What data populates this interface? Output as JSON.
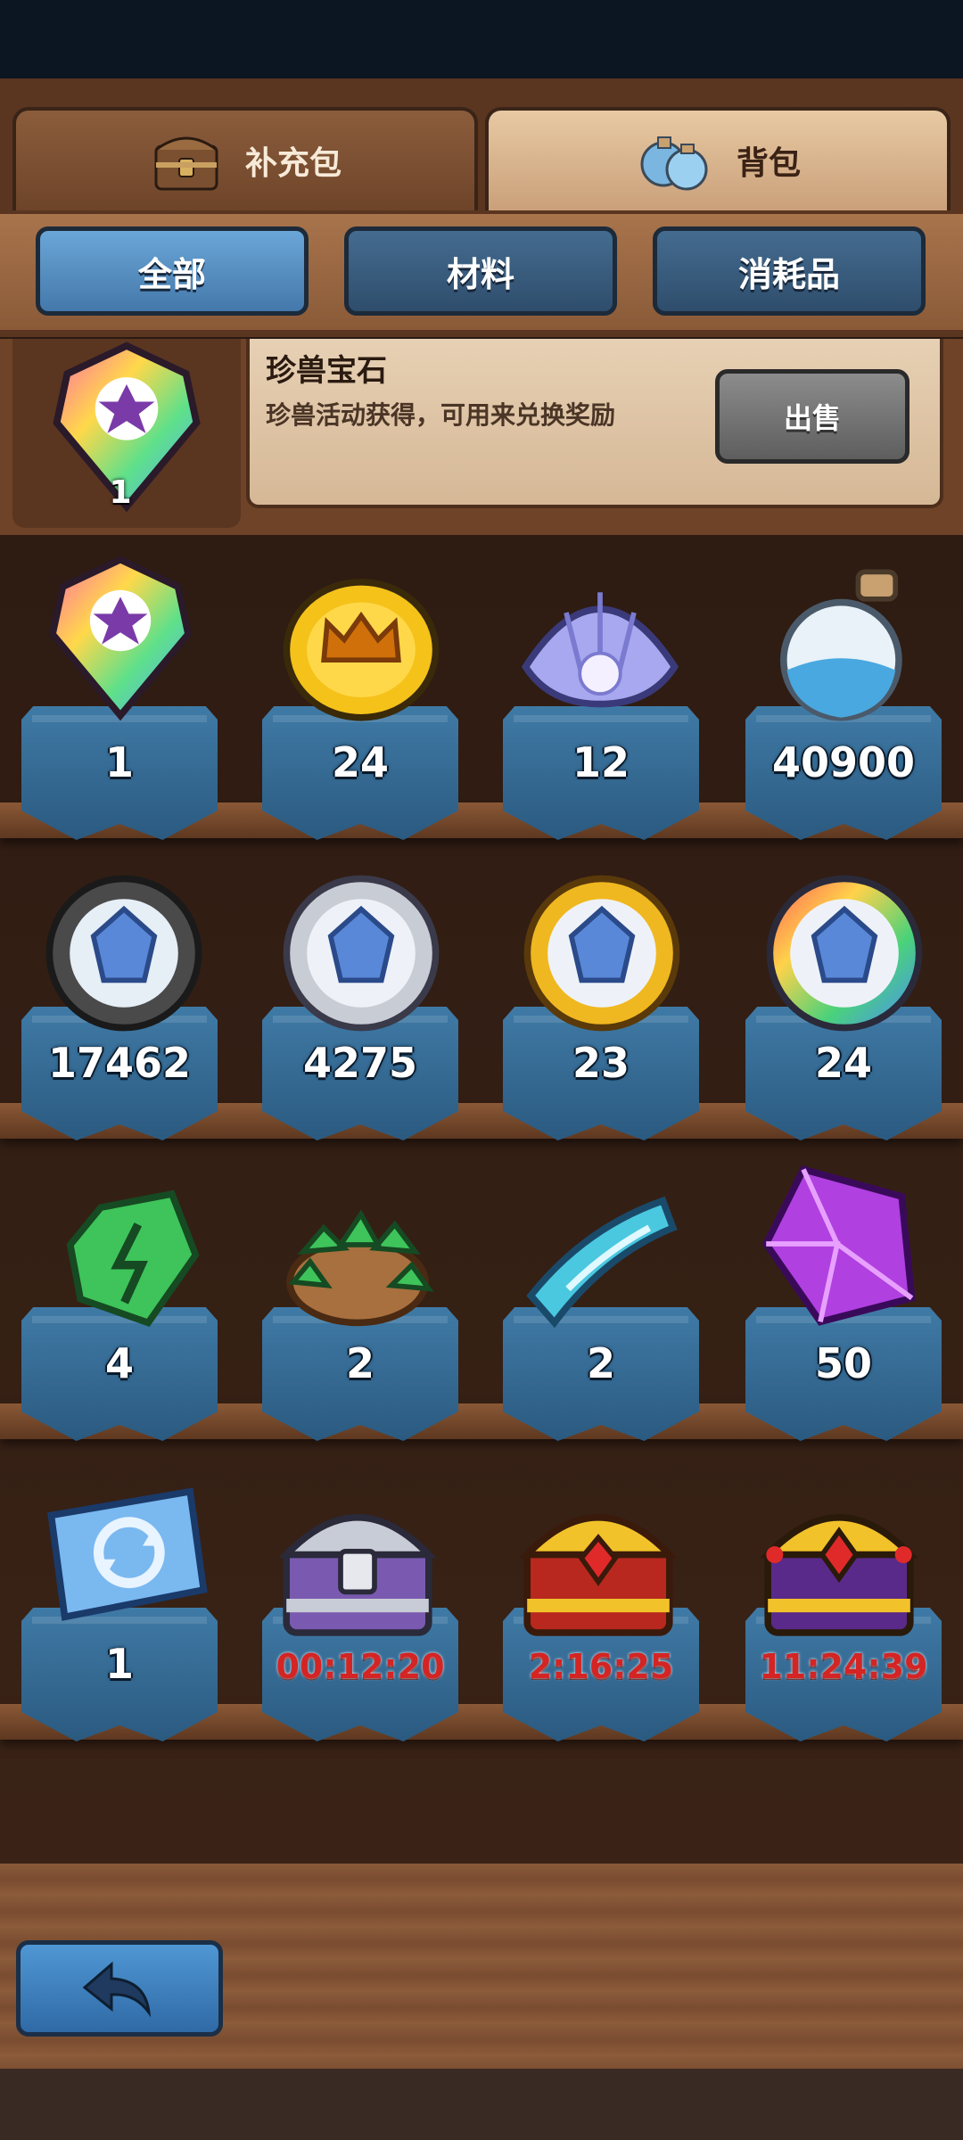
{
  "tabs": [
    {
      "label": "补充包",
      "icon": "chest-icon"
    },
    {
      "label": "背包",
      "icon": "potion-bag-icon"
    }
  ],
  "filters": [
    {
      "label": "全部",
      "active": true
    },
    {
      "label": "材料",
      "active": false
    },
    {
      "label": "消耗品",
      "active": false
    }
  ],
  "detail": {
    "name": "珍兽宝石",
    "description": "珍兽活动获得，可用来兑换奖励",
    "sell_label": "出售",
    "count": "1",
    "icon": "rainbow-gem-icon"
  },
  "items": [
    {
      "icon": "rainbow-gem-icon",
      "qty": "1"
    },
    {
      "icon": "gold-crown-coin-icon",
      "qty": "24"
    },
    {
      "icon": "pearl-shell-icon",
      "qty": "12"
    },
    {
      "icon": "blue-sand-bottle-icon",
      "qty": "40900"
    },
    {
      "icon": "dark-crystal-orb-icon",
      "qty": "17462"
    },
    {
      "icon": "silver-crystal-orb-icon",
      "qty": "4275"
    },
    {
      "icon": "gold-crystal-orb-icon",
      "qty": "23"
    },
    {
      "icon": "rainbow-crystal-orb-icon",
      "qty": "24"
    },
    {
      "icon": "green-rune-stone-icon",
      "qty": "4"
    },
    {
      "icon": "green-stone-bag-icon",
      "qty": "2"
    },
    {
      "icon": "blue-ticket-scroll-icon",
      "qty": "2"
    },
    {
      "icon": "purple-crystal-icon",
      "qty": "50"
    },
    {
      "icon": "refresh-ticket-icon",
      "qty": "1"
    },
    {
      "icon": "silver-chest-icon",
      "qty": "00:12:20",
      "timer": true
    },
    {
      "icon": "gold-chest-icon",
      "qty": "2:16:25",
      "timer": true
    },
    {
      "icon": "royal-chest-icon",
      "qty": "11:24:39",
      "timer": true
    }
  ],
  "colors": {
    "active_tab": "#4478aa",
    "inactive_tab": "#2f4d6c",
    "timer_text": "#d42424",
    "banner": "#3f7aa6"
  }
}
